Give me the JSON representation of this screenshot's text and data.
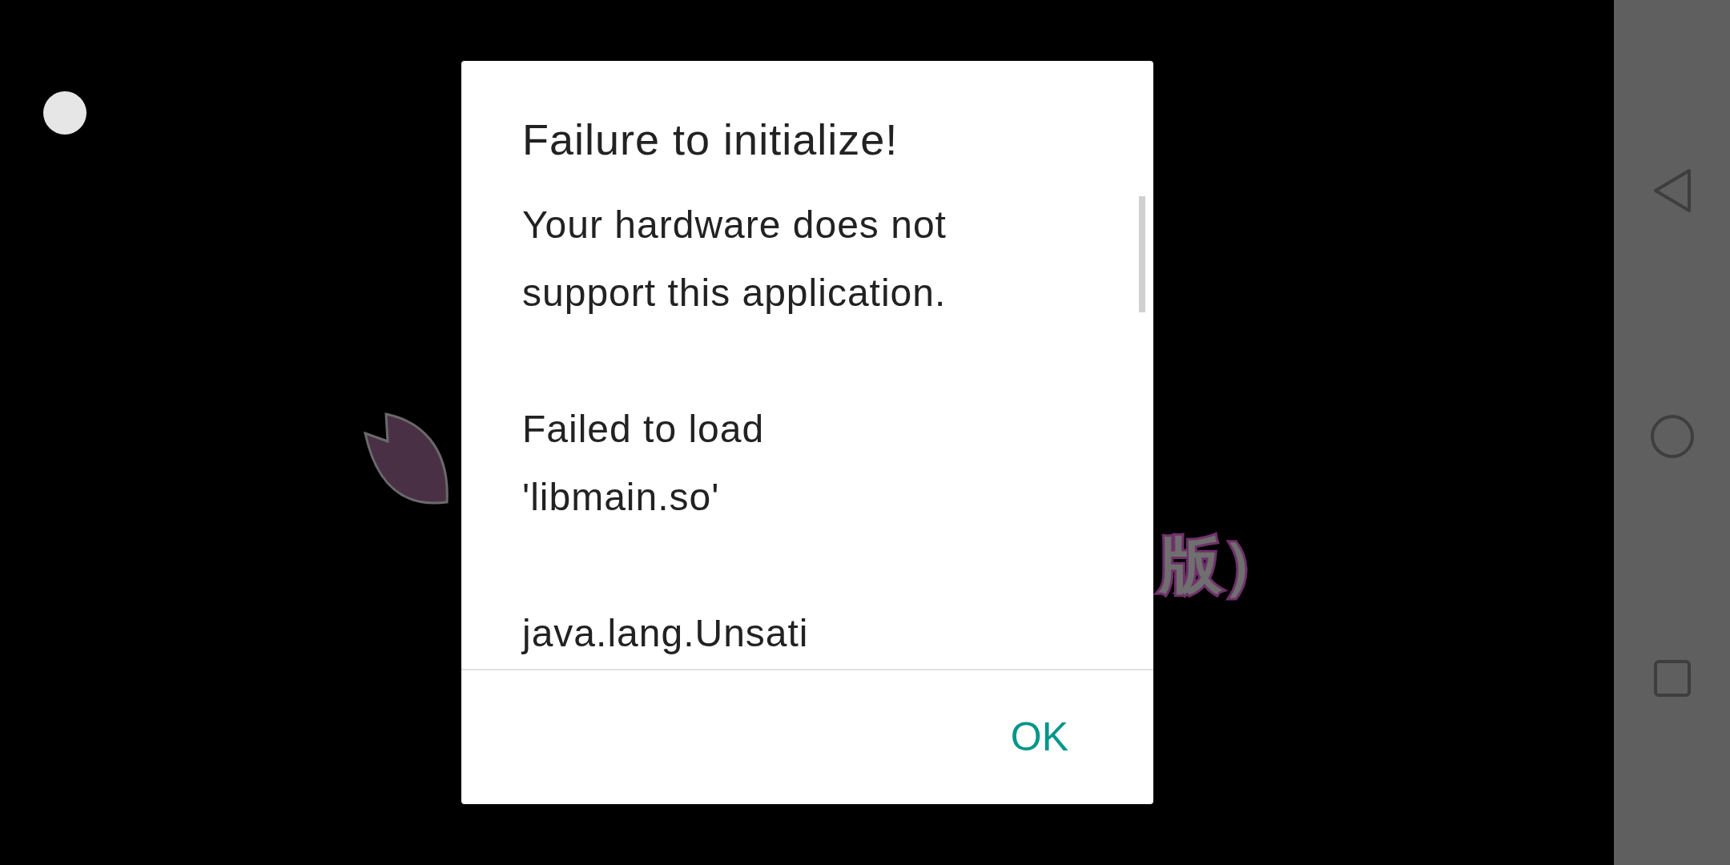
{
  "background": {
    "logo_text": "版）"
  },
  "dialog": {
    "title": "Failure to initialize!",
    "paragraphs": [
      [
        "Your hardware does not",
        "support this application."
      ],
      [
        "Failed to load",
        "'libmain.so'"
      ],
      [
        "java.lang.Unsati"
      ]
    ],
    "buttons": [
      {
        "label": "OK"
      }
    ]
  }
}
